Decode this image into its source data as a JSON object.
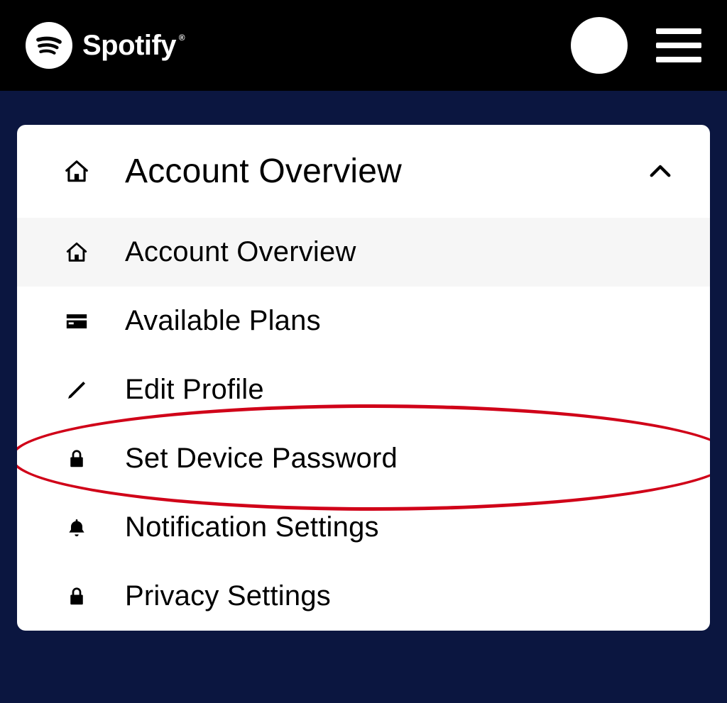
{
  "brand": {
    "name": "Spotify"
  },
  "menu": {
    "section_label": "Account Overview",
    "items": [
      {
        "label": "Account Overview"
      },
      {
        "label": "Available Plans"
      },
      {
        "label": "Edit Profile"
      },
      {
        "label": "Set Device Password"
      },
      {
        "label": "Notification Settings"
      },
      {
        "label": "Privacy Settings"
      }
    ]
  },
  "annotation": {
    "highlight_color": "#d00018",
    "highlighted_item_index": 3
  }
}
